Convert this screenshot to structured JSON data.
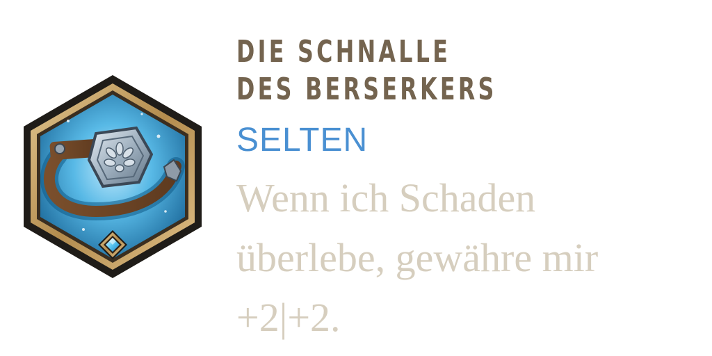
{
  "item": {
    "name": "DIE SCHNALLE DES BERSERKERS",
    "rarity": "SELTEN",
    "description": "Wenn ich Schaden überlebe, gewähre mir +2|+2.",
    "icon": "belt-buckle-icon",
    "rarity_gem_icon": "rarity-gem-icon"
  },
  "colors": {
    "title": "#74644f",
    "rarity": "#4a90d2",
    "description": "#d6cebe",
    "frame_gold": "#c9a86a",
    "frame_dark": "#1f1c18",
    "inner_blue": "#3aa8dd"
  }
}
